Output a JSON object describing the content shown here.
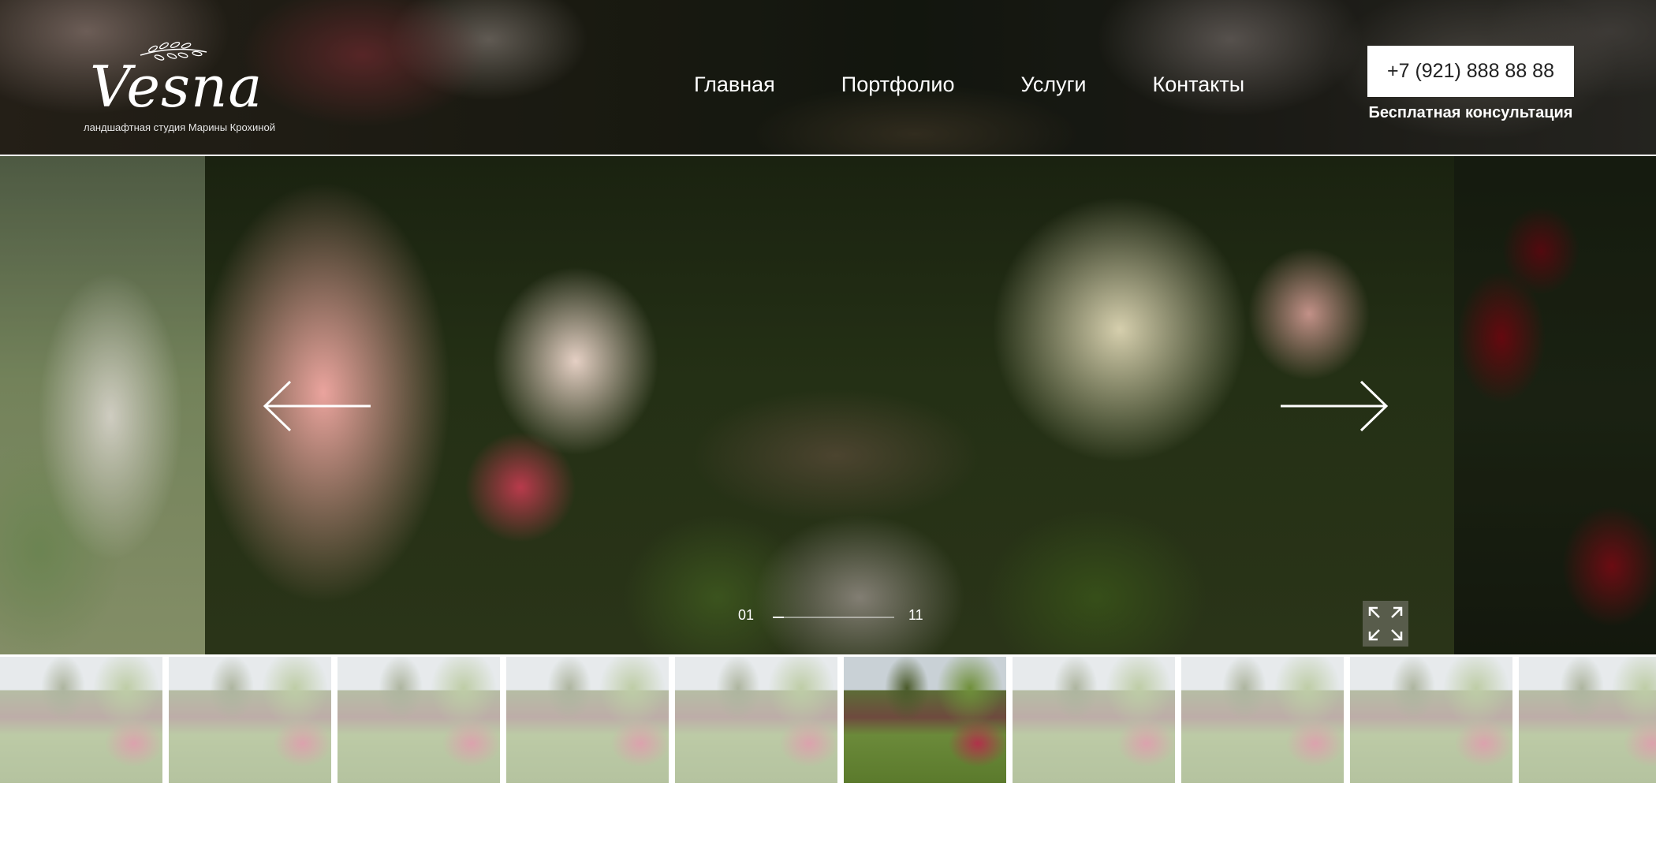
{
  "logo": {
    "wordmark": "Vesna",
    "tagline": "ландшафтная студия Марины Крохиной"
  },
  "nav": {
    "items": [
      {
        "label": "Главная"
      },
      {
        "label": "Портфолио"
      },
      {
        "label": "Услуги"
      },
      {
        "label": "Контакты"
      }
    ]
  },
  "contact": {
    "phone": "+7 (921) 888 88 88",
    "consultation": "Бесплатная консультация"
  },
  "slider": {
    "current": "01",
    "total": "11",
    "progress": 0.09
  },
  "thumbnails": {
    "count": 10,
    "active_index": 5
  },
  "icons": {
    "prev": "arrow-left-icon",
    "next": "arrow-right-icon",
    "fullscreen": "fullscreen-expand-icon",
    "logo_ornament": "leaf-branch-icon"
  }
}
